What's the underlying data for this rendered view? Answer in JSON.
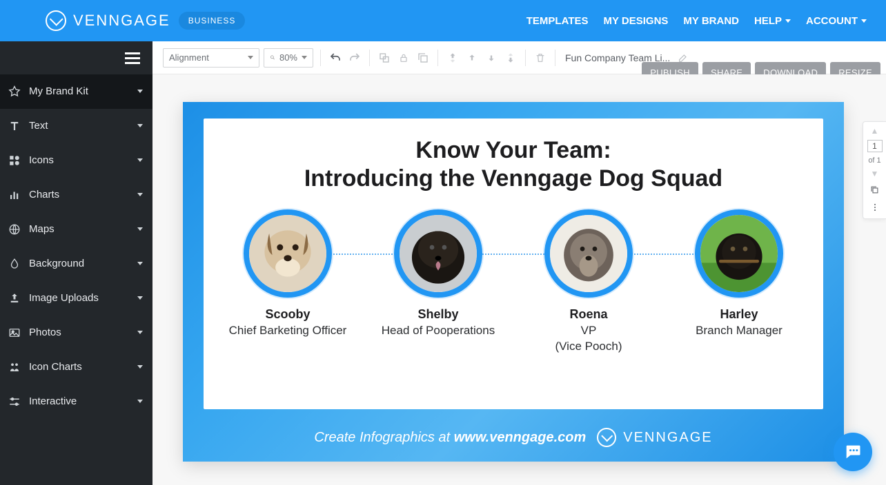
{
  "header": {
    "brand": "VENNGAGE",
    "badge": "BUSINESS",
    "nav": {
      "templates": "TEMPLATES",
      "mydesigns": "MY DESIGNS",
      "mybrand": "MY BRAND",
      "help": "HELP",
      "account": "ACCOUNT"
    }
  },
  "sidebar": {
    "items": [
      {
        "label": "My Brand Kit"
      },
      {
        "label": "Text"
      },
      {
        "label": "Icons"
      },
      {
        "label": "Charts"
      },
      {
        "label": "Maps"
      },
      {
        "label": "Background"
      },
      {
        "label": "Image Uploads"
      },
      {
        "label": "Photos"
      },
      {
        "label": "Icon Charts"
      },
      {
        "label": "Interactive"
      }
    ]
  },
  "toolbar": {
    "alignment": "Alignment",
    "zoom": "80%",
    "doc_name": "Fun Company Team Li..."
  },
  "actions": {
    "publish": "PUBLISH",
    "share": "SHARE",
    "download": "DOWNLOAD",
    "resize": "RESIZE"
  },
  "canvas": {
    "title_l1": "Know Your Team:",
    "title_l2": "Introducing the Venngage Dog Squad",
    "members": [
      {
        "name": "Scooby",
        "title": "Chief Barketing Officer"
      },
      {
        "name": "Shelby",
        "title": "Head of Pooperations"
      },
      {
        "name": "Roena",
        "title": "VP\n(Vice Pooch)"
      },
      {
        "name": "Harley",
        "title": "Branch Manager"
      }
    ],
    "footer_pre": "Create Infographics at ",
    "footer_url": "www.venngage.com",
    "footer_brand": "VENNGAGE"
  },
  "page_nav": {
    "current": "1",
    "total": "of 1"
  }
}
